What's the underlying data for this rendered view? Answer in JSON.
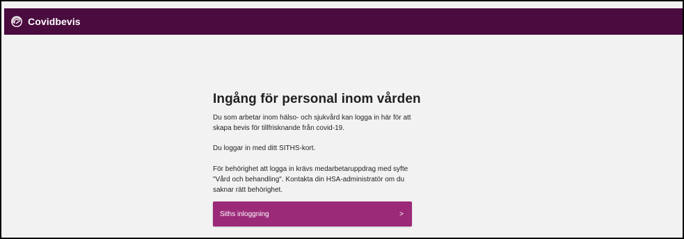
{
  "header": {
    "brand": "Covidbevis",
    "icon": "covidbevis-logo-icon",
    "background_color": "#4a0b3f"
  },
  "main": {
    "title": "Ingång för personal inom vården",
    "paragraphs": [
      "Du som arbetar inom hälso- och sjukvård kan logga in här för att skapa bevis för tillfrisknande från covid-19.",
      "Du loggar in med ditt SITHS-kort.",
      "För behörighet att logga in krävs medarbetaruppdrag med syfte \"Vård och behandling\". Kontakta din HSA-administratör om du saknar rätt behörighet."
    ],
    "login_button": {
      "label": "Siths inloggning",
      "chevron": ">",
      "color": "#9b2a79"
    }
  }
}
